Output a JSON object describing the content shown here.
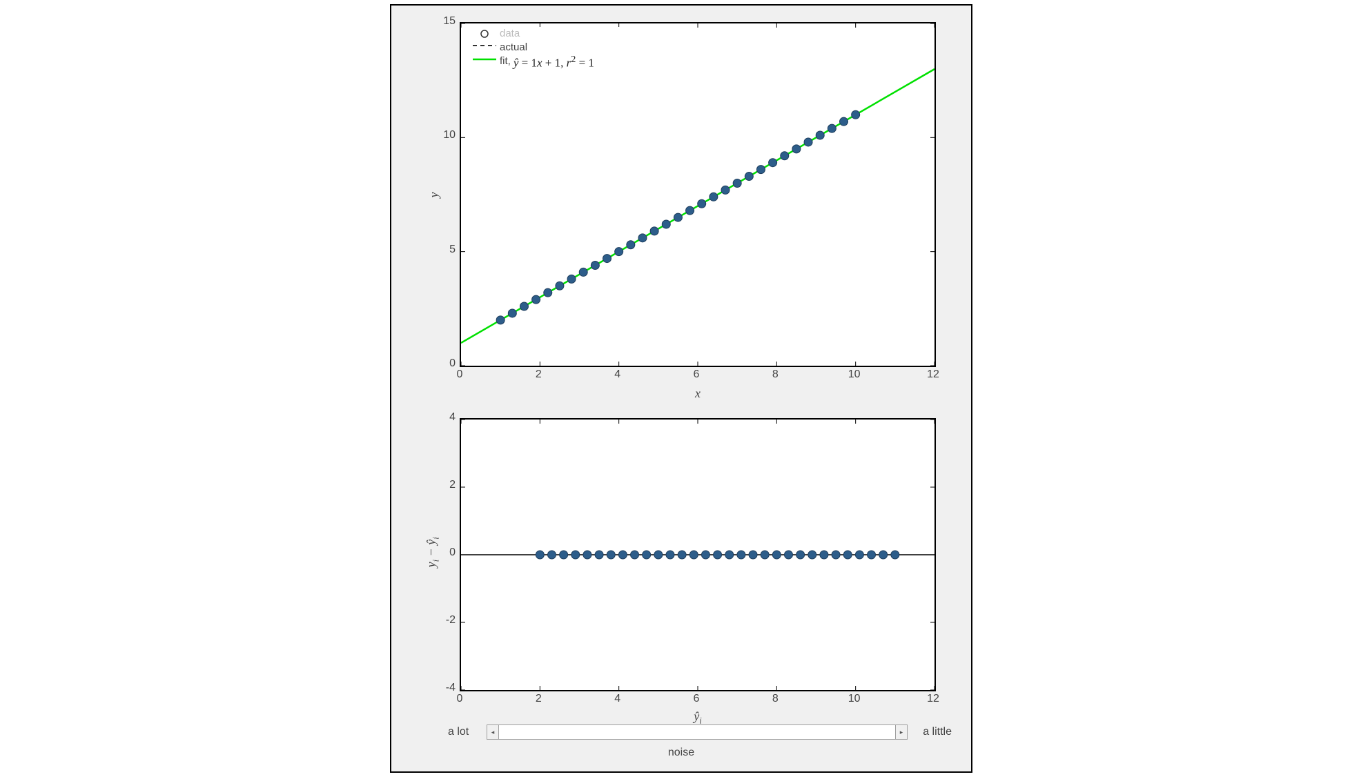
{
  "chart_data": [
    {
      "id": "main",
      "type": "scatter+line",
      "xlabel": "x",
      "ylabel": "y",
      "xlim": [
        0,
        12
      ],
      "ylim": [
        0,
        15
      ],
      "xticks": [
        0,
        2,
        4,
        6,
        8,
        10,
        12
      ],
      "yticks": [
        0,
        5,
        10,
        15
      ],
      "legend": {
        "data_label": "data",
        "actual_label": "actual",
        "fit_label_prefix": "fit,",
        "fit_equation": "ŷ = 1x + 1, r² = 1"
      },
      "fit_line": {
        "x0": 0,
        "y0": 1,
        "x1": 12,
        "y1": 13
      },
      "actual_line": {
        "x0": 0,
        "y0": 1,
        "x1": 12,
        "y1": 13
      },
      "data_points": [
        {
          "x": 1.0,
          "y": 2.0
        },
        {
          "x": 1.3,
          "y": 2.3
        },
        {
          "x": 1.6,
          "y": 2.6
        },
        {
          "x": 1.9,
          "y": 2.9
        },
        {
          "x": 2.2,
          "y": 3.2
        },
        {
          "x": 2.5,
          "y": 3.5
        },
        {
          "x": 2.8,
          "y": 3.8
        },
        {
          "x": 3.1,
          "y": 4.1
        },
        {
          "x": 3.4,
          "y": 4.4
        },
        {
          "x": 3.7,
          "y": 4.7
        },
        {
          "x": 4.0,
          "y": 5.0
        },
        {
          "x": 4.3,
          "y": 5.3
        },
        {
          "x": 4.6,
          "y": 5.6
        },
        {
          "x": 4.9,
          "y": 5.9
        },
        {
          "x": 5.2,
          "y": 6.2
        },
        {
          "x": 5.5,
          "y": 6.5
        },
        {
          "x": 5.8,
          "y": 6.8
        },
        {
          "x": 6.1,
          "y": 7.1
        },
        {
          "x": 6.4,
          "y": 7.4
        },
        {
          "x": 6.7,
          "y": 7.7
        },
        {
          "x": 7.0,
          "y": 8.0
        },
        {
          "x": 7.3,
          "y": 8.3
        },
        {
          "x": 7.6,
          "y": 8.6
        },
        {
          "x": 7.9,
          "y": 8.9
        },
        {
          "x": 8.2,
          "y": 9.2
        },
        {
          "x": 8.5,
          "y": 9.5
        },
        {
          "x": 8.8,
          "y": 9.8
        },
        {
          "x": 9.1,
          "y": 10.1
        },
        {
          "x": 9.4,
          "y": 10.4
        },
        {
          "x": 9.7,
          "y": 10.7
        },
        {
          "x": 10.0,
          "y": 11.0
        }
      ]
    },
    {
      "id": "residuals",
      "type": "scatter",
      "xlabel": "ŷᵢ",
      "ylabel": "yᵢ - ŷᵢ",
      "xlim": [
        0,
        12
      ],
      "ylim": [
        -4,
        4
      ],
      "xticks": [
        0,
        2,
        4,
        6,
        8,
        10,
        12
      ],
      "yticks": [
        -4,
        -2,
        0,
        2,
        4
      ],
      "zero_line_y": 0,
      "data_points": [
        {
          "x": 2.0,
          "y": 0
        },
        {
          "x": 2.3,
          "y": 0
        },
        {
          "x": 2.6,
          "y": 0
        },
        {
          "x": 2.9,
          "y": 0
        },
        {
          "x": 3.2,
          "y": 0
        },
        {
          "x": 3.5,
          "y": 0
        },
        {
          "x": 3.8,
          "y": 0
        },
        {
          "x": 4.1,
          "y": 0
        },
        {
          "x": 4.4,
          "y": 0
        },
        {
          "x": 4.7,
          "y": 0
        },
        {
          "x": 5.0,
          "y": 0
        },
        {
          "x": 5.3,
          "y": 0
        },
        {
          "x": 5.6,
          "y": 0
        },
        {
          "x": 5.9,
          "y": 0
        },
        {
          "x": 6.2,
          "y": 0
        },
        {
          "x": 6.5,
          "y": 0
        },
        {
          "x": 6.8,
          "y": 0
        },
        {
          "x": 7.1,
          "y": 0
        },
        {
          "x": 7.4,
          "y": 0
        },
        {
          "x": 7.7,
          "y": 0
        },
        {
          "x": 8.0,
          "y": 0
        },
        {
          "x": 8.3,
          "y": 0
        },
        {
          "x": 8.6,
          "y": 0
        },
        {
          "x": 8.9,
          "y": 0
        },
        {
          "x": 9.2,
          "y": 0
        },
        {
          "x": 9.5,
          "y": 0
        },
        {
          "x": 9.8,
          "y": 0
        },
        {
          "x": 10.1,
          "y": 0
        },
        {
          "x": 10.4,
          "y": 0
        },
        {
          "x": 10.7,
          "y": 0
        },
        {
          "x": 11.0,
          "y": 0
        }
      ]
    }
  ],
  "slider": {
    "label_left": "a lot",
    "label_right": "a little",
    "caption": "noise",
    "arrow_left": "◂",
    "arrow_right": "▸"
  }
}
